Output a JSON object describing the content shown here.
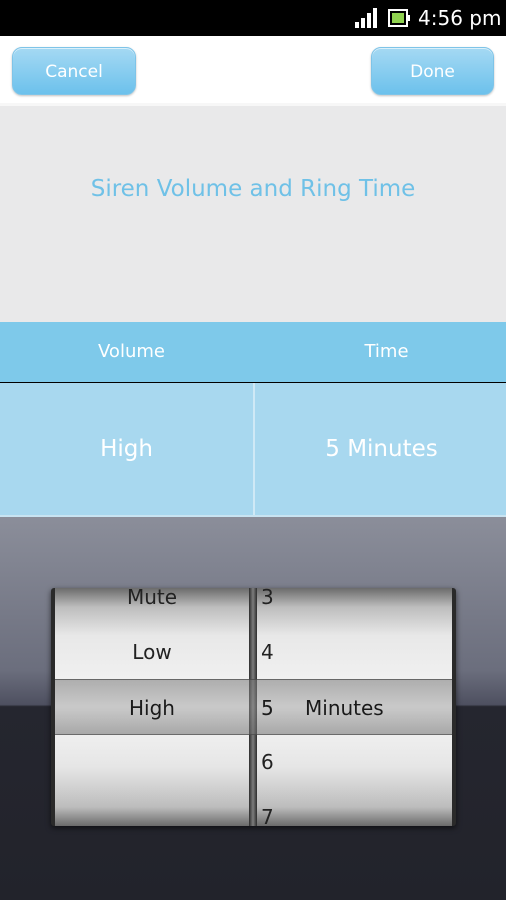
{
  "status_bar": {
    "time": "4:56 pm",
    "icons": [
      "signal-icon",
      "battery-icon"
    ]
  },
  "toolbar": {
    "cancel_label": "Cancel",
    "done_label": "Done"
  },
  "title": "Siren Volume and Ring Time",
  "columns": {
    "volume_header": "Volume",
    "time_header": "Time"
  },
  "values": {
    "volume": "High",
    "time": "5  Minutes"
  },
  "picker": {
    "volume_options": [
      "Mute",
      "Low",
      "High"
    ],
    "time_options": [
      "3",
      "4",
      "5",
      "6",
      "7"
    ],
    "selected_volume": "High",
    "selected_time": "5",
    "time_unit": "Minutes"
  },
  "colors": {
    "accent": "#7ec9ea",
    "title_text": "#6fc1e7",
    "value_row": "#a8d8ef"
  }
}
